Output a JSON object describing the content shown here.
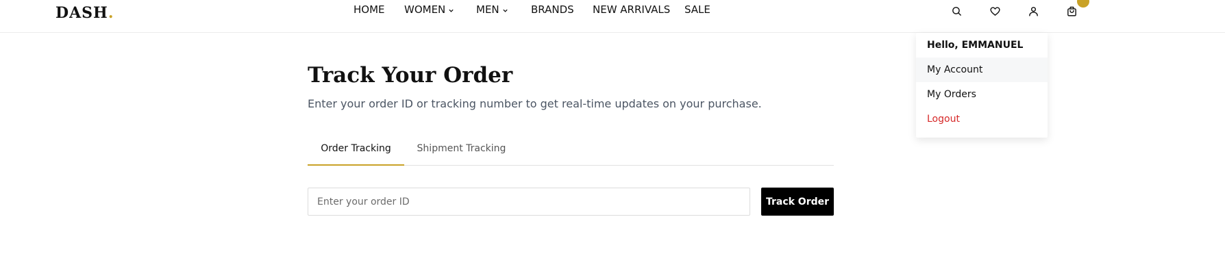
{
  "brand": {
    "name": "DASH",
    "dot": "."
  },
  "nav": {
    "items": [
      {
        "label": "HOME"
      },
      {
        "label": "WOMEN"
      },
      {
        "label": "MEN"
      },
      {
        "label": "BRANDS"
      },
      {
        "label": "NEW ARRIVALS"
      },
      {
        "label": "SALE"
      }
    ]
  },
  "header_icons": {
    "search": "search-icon",
    "wishlist": "heart-icon",
    "account": "user-icon",
    "cart": "bag-icon",
    "cart_badge": ""
  },
  "user_menu": {
    "greeting": "Hello, EMMANUEL",
    "items": [
      {
        "label": "My Account"
      },
      {
        "label": "My Orders"
      },
      {
        "label": "Logout"
      }
    ]
  },
  "page": {
    "title": "Track Your Order",
    "subtitle": "Enter your order ID or tracking number to get real-time updates on your purchase."
  },
  "tabs": [
    {
      "label": "Order Tracking"
    },
    {
      "label": "Shipment Tracking"
    }
  ],
  "form": {
    "placeholder": "Enter your order ID",
    "value": "",
    "button_label": "Track Order"
  },
  "colors": {
    "accent": "#c9a227",
    "logout": "#d62828",
    "button_bg": "#000000"
  }
}
